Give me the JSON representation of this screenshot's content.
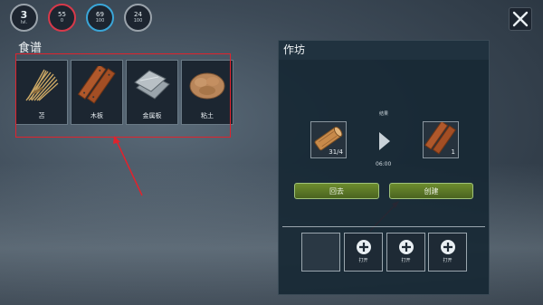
{
  "stats": {
    "level": {
      "value": "3",
      "label": "lvl."
    },
    "health": {
      "value": "55",
      "sub": "0"
    },
    "water": {
      "value": "69",
      "sub": "100"
    },
    "food": {
      "value": "24",
      "sub": "100"
    }
  },
  "colors": {
    "health": "#d8394a",
    "water": "#3aa6d8",
    "accent_green": "#5a7a26",
    "highlight_red": "#e0232d"
  },
  "recipes": {
    "title": "食谱",
    "items": [
      {
        "name": "苫",
        "icon": "thatch-icon"
      },
      {
        "name": "木板",
        "icon": "wood-plank-icon"
      },
      {
        "name": "金属板",
        "icon": "metal-sheet-icon"
      },
      {
        "name": "粘土",
        "icon": "clay-icon"
      }
    ]
  },
  "workshop": {
    "title": "作坊",
    "result_label": "结果",
    "input": {
      "icon": "log-icon",
      "qty": "31/4"
    },
    "output": {
      "icon": "wood-plank-icon",
      "qty": "1"
    },
    "time": "06:00",
    "back_label": "回去",
    "create_label": "创建",
    "queue": [
      {
        "label": "打开"
      },
      {
        "label": "打开"
      },
      {
        "label": "打开"
      }
    ]
  }
}
